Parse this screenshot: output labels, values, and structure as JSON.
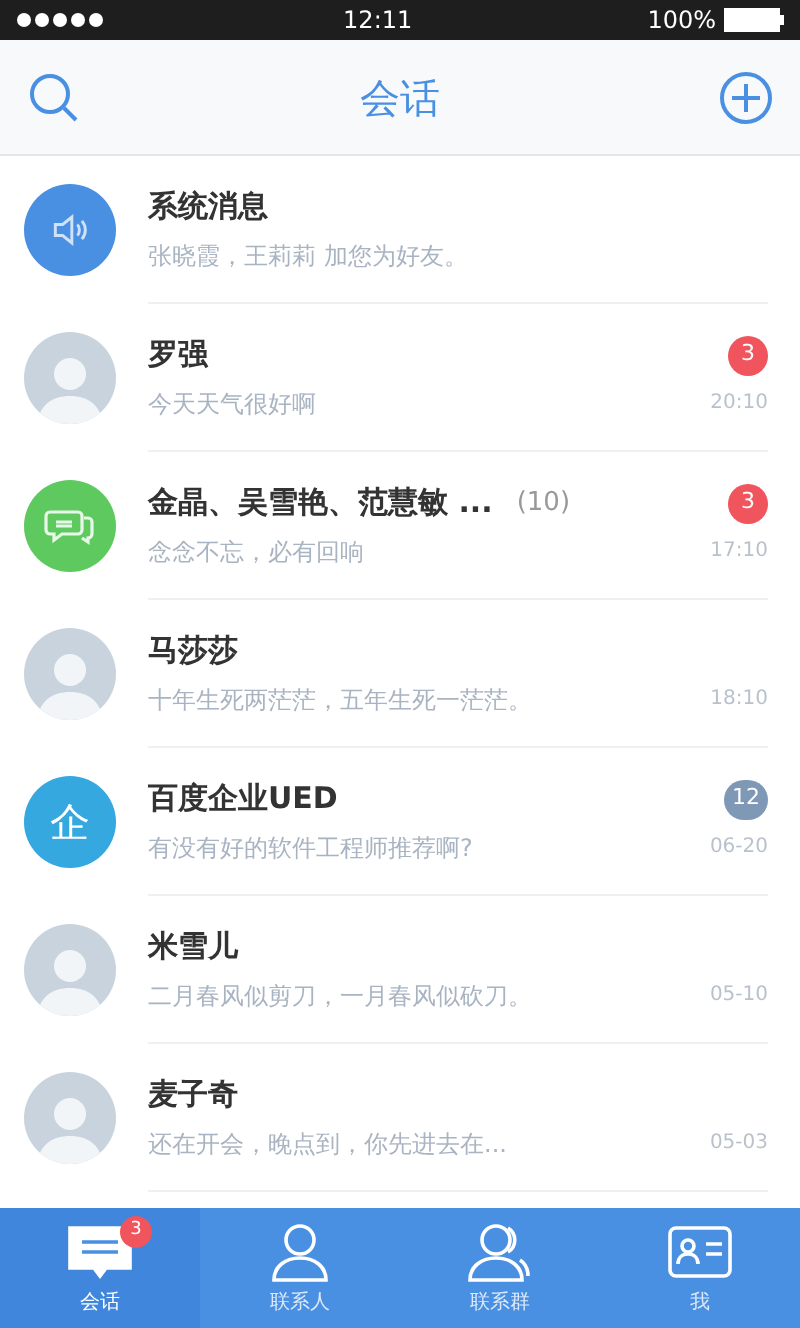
{
  "status_bar": {
    "time": "12:11",
    "battery": "100%"
  },
  "nav": {
    "title": "会话"
  },
  "conversations": [
    {
      "kind": "speaker",
      "name": "系统消息",
      "preview": "张晓霞，王莉莉 加您为好友。"
    },
    {
      "kind": "photo",
      "name": "罗强",
      "preview": "今天天气很好啊",
      "time": "20:10",
      "badge": "3",
      "badge_muted": false
    },
    {
      "kind": "chat",
      "name": "金晶、吴雪艳、范慧敏 ...",
      "count": "(10)",
      "preview": "念念不忘，必有回响",
      "time": "17:10",
      "badge": "3",
      "badge_muted": false
    },
    {
      "kind": "photo",
      "name": "马莎莎",
      "preview": "十年生死两茫茫，五年生死一茫茫。",
      "time": "18:10"
    },
    {
      "kind": "letter",
      "letter": "企",
      "name": "百度企业UED",
      "preview": "有没有好的软件工程师推荐啊?",
      "time": "06-20",
      "badge": "12",
      "badge_muted": true
    },
    {
      "kind": "photo",
      "name": "米雪儿",
      "preview": "二月春风似剪刀，一月春风似砍刀。",
      "time": "05-10"
    },
    {
      "kind": "photo",
      "name": "麦子奇",
      "preview": "还在开会，晚点到，你先进去在...",
      "time": "05-03"
    }
  ],
  "tab_bar": [
    {
      "kind": "chat",
      "label": "会话",
      "selected": true,
      "badge": "3"
    },
    {
      "kind": "person",
      "label": "联系人",
      "selected": false
    },
    {
      "kind": "group",
      "label": "联系群",
      "selected": false
    },
    {
      "kind": "card",
      "label": "我",
      "selected": false
    }
  ]
}
